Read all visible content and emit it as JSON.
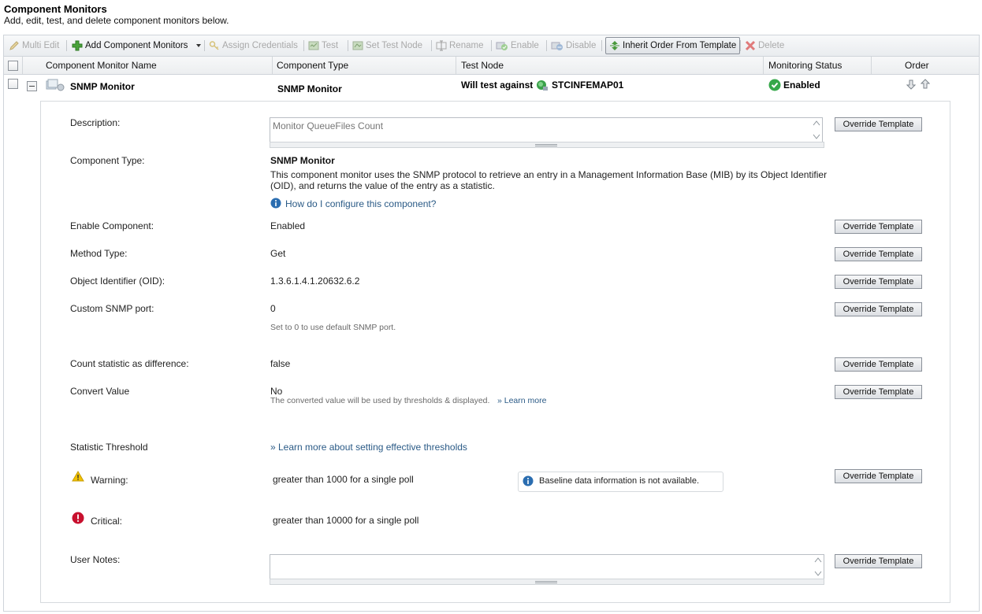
{
  "page": {
    "title": "Component Monitors",
    "subtitle": "Add, edit, test, and delete component monitors below."
  },
  "toolbar": {
    "multi_edit": "Multi Edit",
    "add_component_monitors": "Add Component Monitors",
    "assign_credentials": "Assign Credentials",
    "test": "Test",
    "set_test_node": "Set Test Node",
    "rename": "Rename",
    "enable": "Enable",
    "disable": "Disable",
    "inherit_order": "Inherit Order From Template",
    "delete": "Delete"
  },
  "grid": {
    "columns": {
      "name": "Component Monitor Name",
      "type": "Component Type",
      "test_node": "Test Node",
      "status": "Monitoring Status",
      "order": "Order"
    },
    "row": {
      "name": "SNMP Monitor",
      "type": "SNMP Monitor",
      "test_prefix": "Will test against",
      "test_node": "STCINFEMAP01",
      "status": "Enabled"
    }
  },
  "details": {
    "override_label": "Override Template",
    "description": {
      "label": "Description:",
      "value": "Monitor QueueFiles Count"
    },
    "component_type": {
      "label": "Component Type:",
      "name": "SNMP Monitor",
      "desc_line1": "This component monitor uses the SNMP protocol to retrieve an entry in a Management Information Base (MIB) by its Object Identifier",
      "desc_line2": "(OID), and returns the value of the entry as a statistic.",
      "help_link": "How do I configure this component?"
    },
    "enable_component": {
      "label": "Enable Component:",
      "value": "Enabled"
    },
    "method_type": {
      "label": "Method Type:",
      "value": "Get"
    },
    "oid": {
      "label": "Object Identifier (OID):",
      "value": "1.3.6.1.4.1.20632.6.2"
    },
    "snmp_port": {
      "label": "Custom SNMP port:",
      "value": "0",
      "hint": "Set to 0 to use default SNMP port."
    },
    "count_diff": {
      "label": "Count statistic as difference:",
      "value": "false"
    },
    "convert_value": {
      "label": "Convert Value",
      "value": "No",
      "hint": "The converted value will be used by thresholds & displayed.",
      "link": "» Learn more"
    },
    "threshold": {
      "label": "Statistic Threshold",
      "link": "» Learn more about setting effective thresholds"
    },
    "warning": {
      "label": "Warning:",
      "value": "greater than 1000  for a single poll"
    },
    "critical": {
      "label": "Critical:",
      "value": "greater than 10000  for a single poll"
    },
    "baseline": "Baseline data information is not available.",
    "user_notes": {
      "label": "User Notes:"
    }
  },
  "colors": {
    "link": "#2a5a86",
    "enabled_green": "#2ea043",
    "warning_yellow": "#f2c200",
    "critical_red": "#c8102e"
  }
}
